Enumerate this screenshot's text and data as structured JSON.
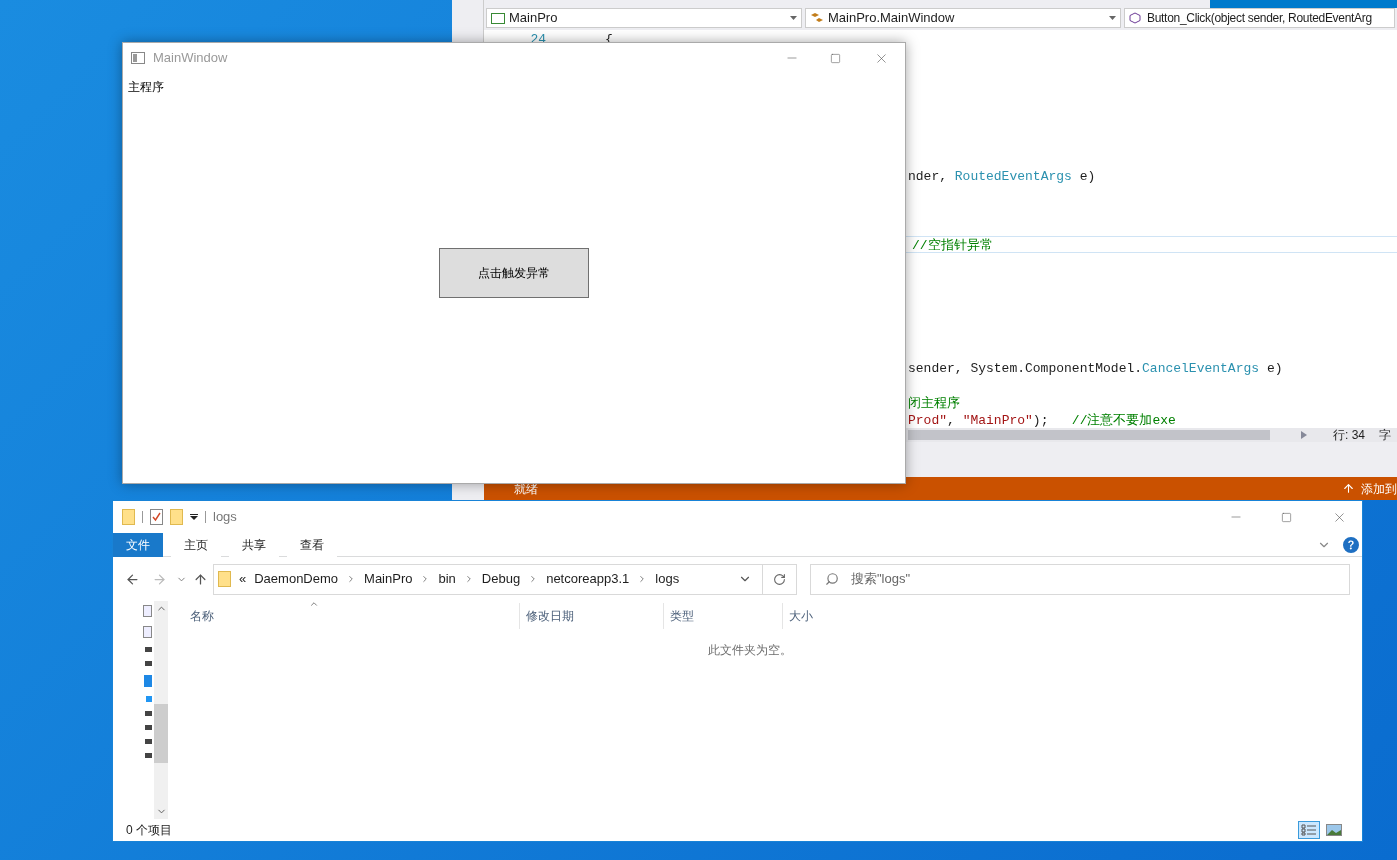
{
  "ide": {
    "nav_dropdowns": [
      {
        "text": "MainPro",
        "kind": "project"
      },
      {
        "text": "MainPro.MainWindow",
        "kind": "class"
      },
      {
        "text": "Button_Click(object sender, RoutedEventArg",
        "kind": "method"
      }
    ],
    "line_number": "24",
    "code_lines": [
      {
        "current": false,
        "segments": [
          {
            "kind": "plain",
            "text": "{"
          }
        ]
      },
      {
        "current": false,
        "segments": [
          {
            "kind": "plain",
            "text": "nder, "
          },
          {
            "kind": "type",
            "text": "RoutedEventArgs"
          },
          {
            "kind": "plain",
            "text": " e)"
          }
        ]
      },
      {
        "current": true,
        "segments": [
          {
            "kind": "comment",
            "text": "//空指针异常"
          }
        ]
      },
      {
        "current": false,
        "segments": [
          {
            "kind": "plain",
            "text": "sender, System.ComponentModel."
          },
          {
            "kind": "type",
            "text": "CancelEventArgs"
          },
          {
            "kind": "plain",
            "text": " e)"
          }
        ]
      },
      {
        "current": false,
        "segments": [
          {
            "kind": "comment",
            "text": "闭主程序"
          }
        ]
      },
      {
        "current": false,
        "segments": [
          {
            "kind": "string",
            "text": "Prod\""
          },
          {
            "kind": "plain",
            "text": ", "
          },
          {
            "kind": "string",
            "text": "\"MainPro\""
          },
          {
            "kind": "plain",
            "text": ");   "
          },
          {
            "kind": "comment",
            "text": "//注意不要加exe"
          }
        ]
      }
    ],
    "cursor_line": "行: 34",
    "cursor_char": "字",
    "status": "就绪",
    "status_right": "添加到"
  },
  "main_window": {
    "title": "MainWindow",
    "label": "主程序",
    "button": "点击触发异常"
  },
  "explorer": {
    "title": "logs",
    "ribbon_tabs": [
      {
        "label": "文件",
        "selected": true
      },
      {
        "label": "主页",
        "selected": false
      },
      {
        "label": "共享",
        "selected": false
      },
      {
        "label": "查看",
        "selected": false
      }
    ],
    "overflow": "«",
    "breadcrumb": [
      "DaemonDemo",
      "MainPro",
      "bin",
      "Debug",
      "netcoreapp3.1",
      "logs"
    ],
    "search": {
      "placeholder": "搜索\"logs\""
    },
    "columns": [
      "名称",
      "修改日期",
      "类型",
      "大小"
    ],
    "empty_message": "此文件夹为空。",
    "status": "0 个项目",
    "views": [
      {
        "kind": "details",
        "selected": true
      },
      {
        "kind": "thumbnails",
        "selected": false
      }
    ]
  }
}
